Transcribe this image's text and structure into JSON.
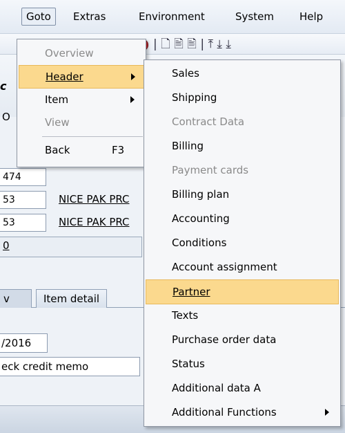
{
  "menubar": {
    "items": [
      {
        "label": "Goto"
      },
      {
        "label": "Extras"
      },
      {
        "label": "Environment"
      },
      {
        "label": "System"
      },
      {
        "label": "Help"
      }
    ]
  },
  "background": {
    "toolbar_glyphs": "| 🗋 🖹 🖹 | ⤒ ⤓ ⤓",
    "doc_number": "474",
    "partner_rows": [
      {
        "number": "53",
        "name": "NICE PAK PRC"
      },
      {
        "number": "53",
        "name": "NICE PAK PRC"
      }
    ],
    "value_field": "0",
    "tabs": [
      {
        "label": "v"
      },
      {
        "label": "Item detail"
      }
    ],
    "date_field": "/2016",
    "credit_field": "eck credit memo"
  },
  "goto_menu": {
    "items": [
      {
        "label": "Overview",
        "shortcut": "",
        "disabled": true,
        "submenu": false
      },
      {
        "label": "Header",
        "shortcut": "",
        "disabled": false,
        "submenu": true,
        "highlighted": true
      },
      {
        "label": "Item",
        "shortcut": "",
        "disabled": false,
        "submenu": true
      },
      {
        "label": "View",
        "shortcut": "",
        "disabled": true,
        "submenu": false
      },
      {
        "label": "Back",
        "shortcut": "F3",
        "disabled": false,
        "submenu": false
      }
    ]
  },
  "header_submenu": {
    "items": [
      {
        "label": "Sales",
        "disabled": false
      },
      {
        "label": "Shipping",
        "disabled": false
      },
      {
        "label": "Contract Data",
        "disabled": true
      },
      {
        "label": "Billing",
        "disabled": false
      },
      {
        "label": "Payment cards",
        "disabled": true
      },
      {
        "label": "Billing plan",
        "disabled": false
      },
      {
        "label": "Accounting",
        "disabled": false
      },
      {
        "label": "Conditions",
        "disabled": false
      },
      {
        "label": "Account assignment",
        "disabled": false
      },
      {
        "label": "Partner",
        "disabled": false,
        "highlighted": true
      },
      {
        "label": "Texts",
        "disabled": false
      },
      {
        "label": "Purchase order data",
        "disabled": false
      },
      {
        "label": "Status",
        "disabled": false
      },
      {
        "label": "Additional data A",
        "disabled": false
      },
      {
        "label": "Additional Functions",
        "disabled": false,
        "submenu": true
      }
    ]
  },
  "colors": {
    "highlight": "#fbd98e",
    "menu_bg": "#f6f7f9",
    "disabled_text": "#8a8a8a"
  }
}
